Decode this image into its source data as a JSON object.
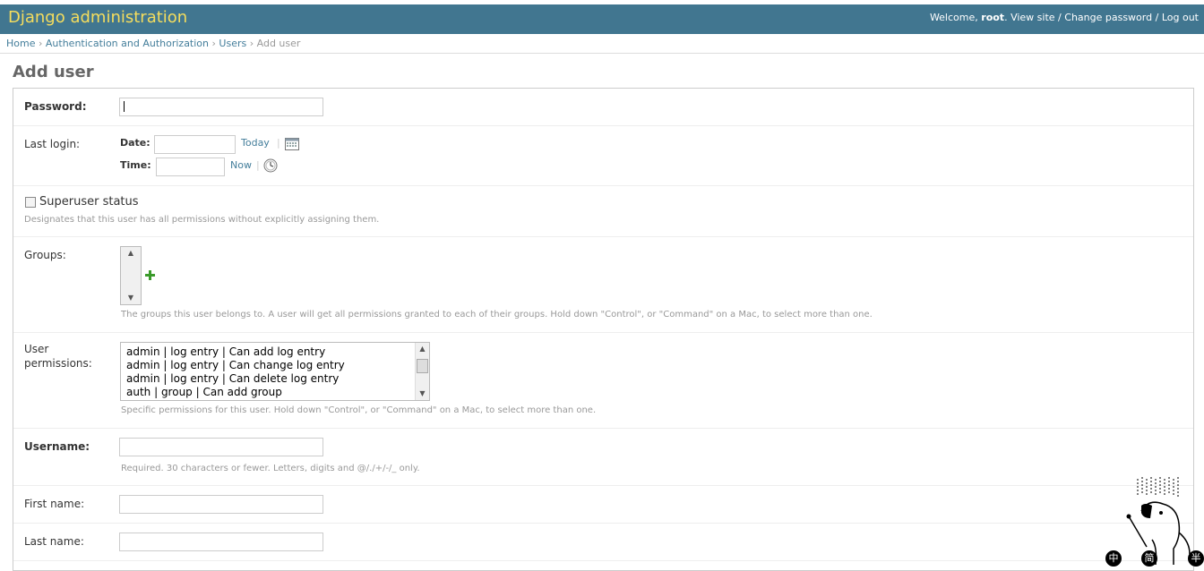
{
  "header": {
    "title": "Django administration",
    "welcome": "Welcome,",
    "user": "root",
    "view_site": "View site",
    "change_password": "Change password",
    "log_out": "Log out",
    "separator": "/"
  },
  "breadcrumbs": {
    "home": "Home",
    "app": "Authentication and Authorization",
    "model": "Users",
    "current": "Add user",
    "separator": "›"
  },
  "page_title": "Add user",
  "form": {
    "password": {
      "label": "Password:",
      "value": ""
    },
    "last_login": {
      "label": "Last login:",
      "date_label": "Date:",
      "date_value": "",
      "today": "Today",
      "time_label": "Time:",
      "time_value": "",
      "now": "Now",
      "separator": "|"
    },
    "superuser": {
      "label": "Superuser status",
      "checked": false,
      "help": "Designates that this user has all permissions without explicitly assigning them."
    },
    "groups": {
      "label": "Groups:",
      "options": [],
      "help": "The groups this user belongs to. A user will get all permissions granted to each of their groups. Hold down \"Control\", or \"Command\" on a Mac, to select more than one."
    },
    "user_permissions": {
      "label_line1": "User",
      "label_line2": "permissions:",
      "options": [
        "admin | log entry | Can add log entry",
        "admin | log entry | Can change log entry",
        "admin | log entry | Can delete log entry",
        "auth | group | Can add group"
      ],
      "help": "Specific permissions for this user. Hold down \"Control\", or \"Command\" on a Mac, to select more than one."
    },
    "username": {
      "label": "Username:",
      "value": "",
      "help": "Required. 30 characters or fewer. Letters, digits and @/./+/-/_ only."
    },
    "first_name": {
      "label": "First name:",
      "value": ""
    },
    "last_name": {
      "label": "Last name:",
      "value": ""
    }
  },
  "colors": {
    "header_bg": "#417690",
    "brand": "#f5dd5d",
    "link": "#447e9b",
    "add_icon": "#3a9a2a"
  },
  "mascot": {
    "glyphs": [
      "中",
      "简",
      "半"
    ]
  }
}
